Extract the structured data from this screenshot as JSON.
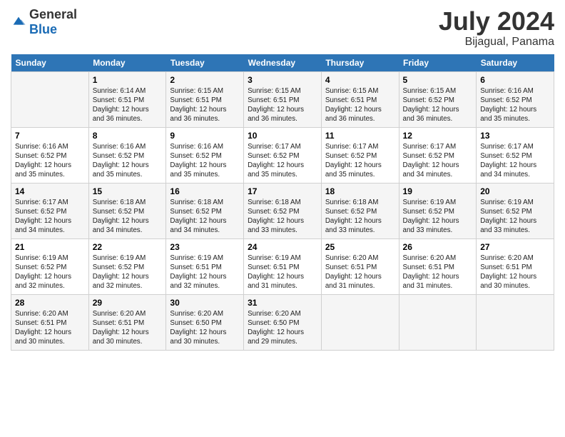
{
  "logo": {
    "general": "General",
    "blue": "Blue"
  },
  "title": "July 2024",
  "subtitle": "Bijagual, Panama",
  "days_header": [
    "Sunday",
    "Monday",
    "Tuesday",
    "Wednesday",
    "Thursday",
    "Friday",
    "Saturday"
  ],
  "weeks": [
    [
      {
        "day": "",
        "info": ""
      },
      {
        "day": "1",
        "info": "Sunrise: 6:14 AM\nSunset: 6:51 PM\nDaylight: 12 hours\nand 36 minutes."
      },
      {
        "day": "2",
        "info": "Sunrise: 6:15 AM\nSunset: 6:51 PM\nDaylight: 12 hours\nand 36 minutes."
      },
      {
        "day": "3",
        "info": "Sunrise: 6:15 AM\nSunset: 6:51 PM\nDaylight: 12 hours\nand 36 minutes."
      },
      {
        "day": "4",
        "info": "Sunrise: 6:15 AM\nSunset: 6:51 PM\nDaylight: 12 hours\nand 36 minutes."
      },
      {
        "day": "5",
        "info": "Sunrise: 6:15 AM\nSunset: 6:52 PM\nDaylight: 12 hours\nand 36 minutes."
      },
      {
        "day": "6",
        "info": "Sunrise: 6:16 AM\nSunset: 6:52 PM\nDaylight: 12 hours\nand 35 minutes."
      }
    ],
    [
      {
        "day": "7",
        "info": "Sunrise: 6:16 AM\nSunset: 6:52 PM\nDaylight: 12 hours\nand 35 minutes."
      },
      {
        "day": "8",
        "info": "Sunrise: 6:16 AM\nSunset: 6:52 PM\nDaylight: 12 hours\nand 35 minutes."
      },
      {
        "day": "9",
        "info": "Sunrise: 6:16 AM\nSunset: 6:52 PM\nDaylight: 12 hours\nand 35 minutes."
      },
      {
        "day": "10",
        "info": "Sunrise: 6:17 AM\nSunset: 6:52 PM\nDaylight: 12 hours\nand 35 minutes."
      },
      {
        "day": "11",
        "info": "Sunrise: 6:17 AM\nSunset: 6:52 PM\nDaylight: 12 hours\nand 35 minutes."
      },
      {
        "day": "12",
        "info": "Sunrise: 6:17 AM\nSunset: 6:52 PM\nDaylight: 12 hours\nand 34 minutes."
      },
      {
        "day": "13",
        "info": "Sunrise: 6:17 AM\nSunset: 6:52 PM\nDaylight: 12 hours\nand 34 minutes."
      }
    ],
    [
      {
        "day": "14",
        "info": "Sunrise: 6:17 AM\nSunset: 6:52 PM\nDaylight: 12 hours\nand 34 minutes."
      },
      {
        "day": "15",
        "info": "Sunrise: 6:18 AM\nSunset: 6:52 PM\nDaylight: 12 hours\nand 34 minutes."
      },
      {
        "day": "16",
        "info": "Sunrise: 6:18 AM\nSunset: 6:52 PM\nDaylight: 12 hours\nand 34 minutes."
      },
      {
        "day": "17",
        "info": "Sunrise: 6:18 AM\nSunset: 6:52 PM\nDaylight: 12 hours\nand 33 minutes."
      },
      {
        "day": "18",
        "info": "Sunrise: 6:18 AM\nSunset: 6:52 PM\nDaylight: 12 hours\nand 33 minutes."
      },
      {
        "day": "19",
        "info": "Sunrise: 6:19 AM\nSunset: 6:52 PM\nDaylight: 12 hours\nand 33 minutes."
      },
      {
        "day": "20",
        "info": "Sunrise: 6:19 AM\nSunset: 6:52 PM\nDaylight: 12 hours\nand 33 minutes."
      }
    ],
    [
      {
        "day": "21",
        "info": "Sunrise: 6:19 AM\nSunset: 6:52 PM\nDaylight: 12 hours\nand 32 minutes."
      },
      {
        "day": "22",
        "info": "Sunrise: 6:19 AM\nSunset: 6:52 PM\nDaylight: 12 hours\nand 32 minutes."
      },
      {
        "day": "23",
        "info": "Sunrise: 6:19 AM\nSunset: 6:51 PM\nDaylight: 12 hours\nand 32 minutes."
      },
      {
        "day": "24",
        "info": "Sunrise: 6:19 AM\nSunset: 6:51 PM\nDaylight: 12 hours\nand 31 minutes."
      },
      {
        "day": "25",
        "info": "Sunrise: 6:20 AM\nSunset: 6:51 PM\nDaylight: 12 hours\nand 31 minutes."
      },
      {
        "day": "26",
        "info": "Sunrise: 6:20 AM\nSunset: 6:51 PM\nDaylight: 12 hours\nand 31 minutes."
      },
      {
        "day": "27",
        "info": "Sunrise: 6:20 AM\nSunset: 6:51 PM\nDaylight: 12 hours\nand 30 minutes."
      }
    ],
    [
      {
        "day": "28",
        "info": "Sunrise: 6:20 AM\nSunset: 6:51 PM\nDaylight: 12 hours\nand 30 minutes."
      },
      {
        "day": "29",
        "info": "Sunrise: 6:20 AM\nSunset: 6:51 PM\nDaylight: 12 hours\nand 30 minutes."
      },
      {
        "day": "30",
        "info": "Sunrise: 6:20 AM\nSunset: 6:50 PM\nDaylight: 12 hours\nand 30 minutes."
      },
      {
        "day": "31",
        "info": "Sunrise: 6:20 AM\nSunset: 6:50 PM\nDaylight: 12 hours\nand 29 minutes."
      },
      {
        "day": "",
        "info": ""
      },
      {
        "day": "",
        "info": ""
      },
      {
        "day": "",
        "info": ""
      }
    ]
  ]
}
